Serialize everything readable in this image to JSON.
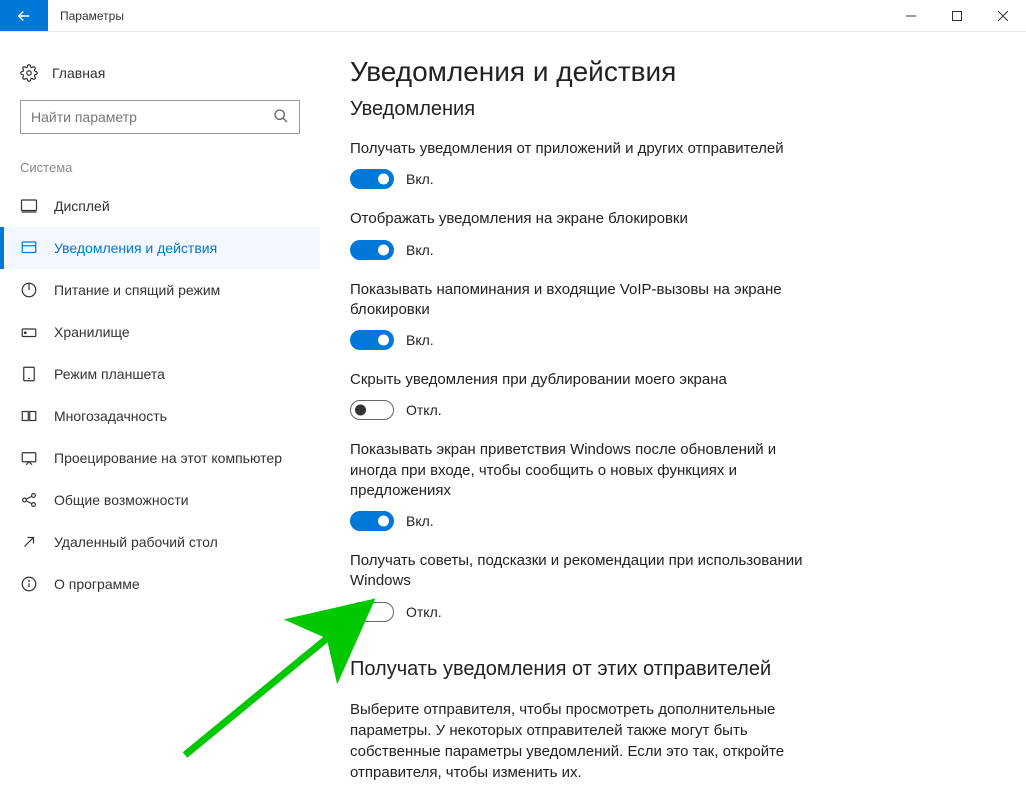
{
  "window": {
    "title": "Параметры"
  },
  "sidebar": {
    "home": "Главная",
    "search_placeholder": "Найти параметр",
    "category": "Система",
    "items": [
      {
        "label": "Дисплей"
      },
      {
        "label": "Уведомления и действия"
      },
      {
        "label": "Питание и спящий режим"
      },
      {
        "label": "Хранилище"
      },
      {
        "label": "Режим планшета"
      },
      {
        "label": "Многозадачность"
      },
      {
        "label": "Проецирование на этот компьютер"
      },
      {
        "label": "Общие возможности"
      },
      {
        "label": "Удаленный рабочий стол"
      },
      {
        "label": "О программе"
      }
    ]
  },
  "main": {
    "heading": "Уведомления и действия",
    "subheading": "Уведомления",
    "on_text": "Вкл.",
    "off_text": "Откл.",
    "settings": [
      {
        "label": "Получать уведомления от приложений и других отправителей",
        "on": true
      },
      {
        "label": "Отображать уведомления на экране блокировки",
        "on": true
      },
      {
        "label": "Показывать напоминания и входящие VoIP-вызовы на экране блокировки",
        "on": true
      },
      {
        "label": "Скрыть уведомления при дублировании моего экрана",
        "on": false
      },
      {
        "label": "Показывать экран приветствия Windows после обновлений и иногда при входе, чтобы сообщить о новых функциях и предложениях",
        "on": true
      },
      {
        "label": "Получать советы, подсказки и рекомендации при использовании Windows",
        "on": false
      }
    ],
    "senders_heading": "Получать уведомления от этих отправителей",
    "senders_desc": "Выберите отправителя, чтобы просмотреть дополнительные параметры. У некоторых отправителей также могут быть собственные параметры уведомлений. Если это так, откройте отправителя, чтобы изменить их."
  }
}
